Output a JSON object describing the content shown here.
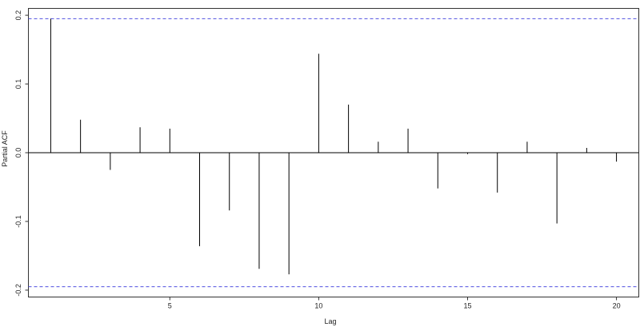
{
  "chart_data": {
    "type": "bar",
    "xlabel": "Lag",
    "ylabel": "Partial ACF",
    "xlim": [
      0.25,
      20.75
    ],
    "ylim": [
      -0.21,
      0.21
    ],
    "x_ticks": [
      5,
      10,
      15,
      20
    ],
    "y_ticks": [
      -0.2,
      -0.1,
      0.0,
      0.1,
      0.2
    ],
    "y_tick_labels": [
      "-0.2",
      "-0.1",
      "0.0",
      "0.1",
      "0.2"
    ],
    "x_tick_labels": [
      "5",
      "10",
      "15",
      "20"
    ],
    "confidence_bound": 0.195,
    "lags": [
      1,
      2,
      3,
      4,
      5,
      6,
      7,
      8,
      9,
      10,
      11,
      12,
      13,
      14,
      15,
      16,
      17,
      18,
      19,
      20
    ],
    "values": [
      0.195,
      0.048,
      -0.025,
      0.037,
      0.035,
      -0.136,
      -0.084,
      -0.169,
      -0.177,
      0.144,
      0.07,
      0.016,
      0.035,
      -0.052,
      -0.002,
      -0.058,
      0.016,
      -0.103,
      0.007,
      -0.013
    ],
    "colors": {
      "bars": "#000000",
      "axis": "#333333",
      "bounds": "#5050e0",
      "zero_line": "#000000"
    },
    "grid": false
  }
}
